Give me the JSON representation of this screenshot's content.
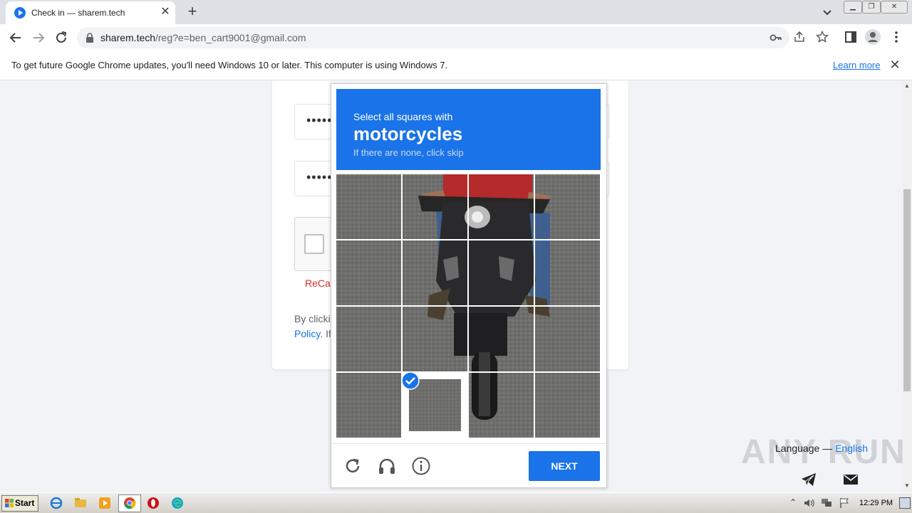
{
  "browser": {
    "tab_title": "Check in — sharem.tech",
    "tab_close": "✕",
    "new_tab": "+",
    "url_host": "sharem.tech",
    "url_path": "/reg?e=ben_cart9001@gmail.com"
  },
  "infobar": {
    "message": "To get future Google Chrome updates, you'll need Windows 10 or later. This computer is using Windows 7.",
    "learn_more": "Learn more",
    "close": "✕"
  },
  "page": {
    "password_mask": "•••••",
    "confirm_mask": "•••••",
    "recaptcha_error": "ReCap",
    "terms_text": "By clicki",
    "terms_policy": "Policy.",
    "terms_tail": " If",
    "language_label": "Language — ",
    "language_value": "English",
    "watermark": "ANY RUN"
  },
  "captcha": {
    "line1": "Select all squares with",
    "object": "motorcycles",
    "line3": "If there are none, click skip",
    "selected_tiles": [
      13
    ],
    "next_label": "NEXT",
    "accent": "#1a73e8"
  },
  "taskbar": {
    "start_label": "Start",
    "clock": "12:29 PM"
  }
}
